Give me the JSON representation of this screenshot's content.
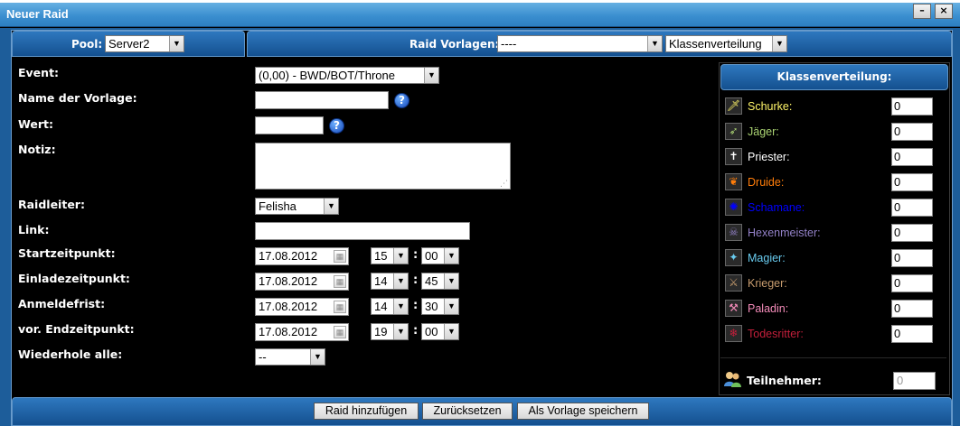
{
  "window": {
    "title": "Neuer Raid",
    "minimize": "–",
    "close": "×"
  },
  "header": {
    "pool_label": "Pool:",
    "pool_value": "Server2",
    "template_label": "Raid Vorlagen:",
    "template_value": "----",
    "class_dist_value": "Klassenverteilung"
  },
  "form": {
    "event_label": "Event:",
    "event_value": "(0,00) - BWD/BOT/Throne",
    "template_name_label": "Name der Vorlage:",
    "template_name_value": "",
    "value_label": "Wert:",
    "value_value": "",
    "note_label": "Notiz:",
    "raidleader_label": "Raidleiter:",
    "raidleader_value": "Felisha",
    "link_label": "Link:",
    "link_value": "",
    "start_label": "Startzeitpunkt:",
    "start_date": "17.08.2012",
    "start_hour": "15",
    "start_min": "00",
    "invite_label": "Einladezeitpunkt:",
    "invite_date": "17.08.2012",
    "invite_hour": "14",
    "invite_min": "45",
    "deadline_label": "Anmeldefrist:",
    "deadline_date": "17.08.2012",
    "deadline_hour": "14",
    "deadline_min": "30",
    "end_label": "vor. Endzeitpunkt:",
    "end_date": "17.08.2012",
    "end_hour": "19",
    "end_min": "00",
    "repeat_label": "Wiederhole alle:",
    "repeat_value": "--",
    "colon": ":",
    "help": "?"
  },
  "classes": {
    "title": "Klassenverteilung:",
    "items": [
      {
        "name": "Schurke:",
        "value": "0",
        "color": "#fff569",
        "icon": "dagger-icon"
      },
      {
        "name": "Jäger:",
        "value": "0",
        "color": "#abd473",
        "icon": "bow-icon"
      },
      {
        "name": "Priester:",
        "value": "0",
        "color": "#ffffff",
        "icon": "staff-icon"
      },
      {
        "name": "Druide:",
        "value": "0",
        "color": "#ff7d0a",
        "icon": "paw-icon"
      },
      {
        "name": "Schamane:",
        "value": "0",
        "color": "#0000ff",
        "icon": "totem-icon"
      },
      {
        "name": "Hexenmeister:",
        "value": "0",
        "color": "#9482c9",
        "icon": "skull-icon"
      },
      {
        "name": "Magier:",
        "value": "0",
        "color": "#69ccf0",
        "icon": "wand-icon"
      },
      {
        "name": "Krieger:",
        "value": "0",
        "color": "#c79c6e",
        "icon": "sword-icon"
      },
      {
        "name": "Paladin:",
        "value": "0",
        "color": "#f58cba",
        "icon": "hammer-icon"
      },
      {
        "name": "Todesritter:",
        "value": "0",
        "color": "#c41f3b",
        "icon": "rune-icon"
      }
    ],
    "participants_label": "Teilnehmer:",
    "participants_value": "0"
  },
  "footer": {
    "add_raid": "Raid hinzufügen",
    "reset": "Zurücksetzen",
    "save_template": "Als Vorlage speichern"
  }
}
